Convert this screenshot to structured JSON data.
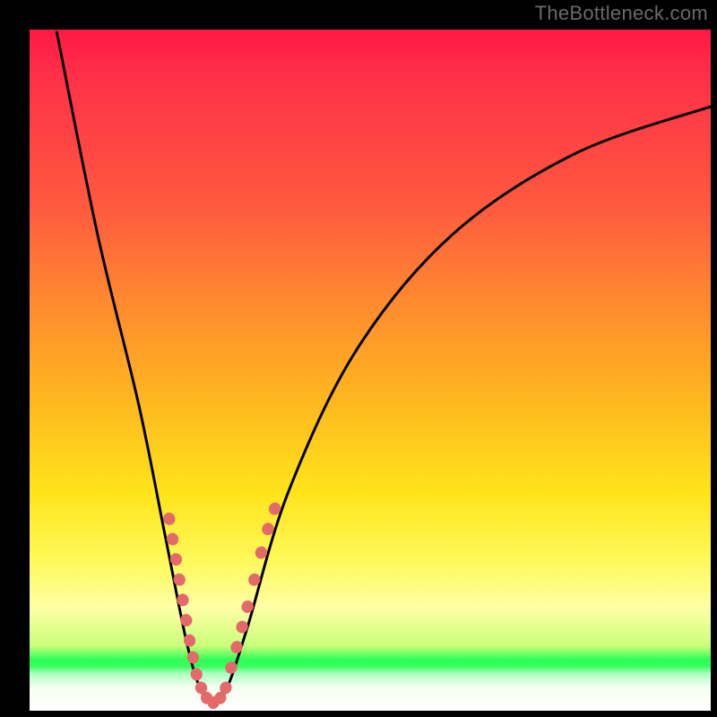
{
  "watermark": "TheBottleneck.com",
  "colors": {
    "frame": "#000000",
    "curve": "#000000",
    "marker_fill": "#e46a6a",
    "marker_stroke": "#b84a4a",
    "gradient_stops": [
      {
        "pos": 0.0,
        "hex": "#ff1845"
      },
      {
        "pos": 0.06,
        "hex": "#ff2e48"
      },
      {
        "pos": 0.26,
        "hex": "#ff5a3f"
      },
      {
        "pos": 0.4,
        "hex": "#ff8a2f"
      },
      {
        "pos": 0.55,
        "hex": "#ffb91f"
      },
      {
        "pos": 0.68,
        "hex": "#ffe41a"
      },
      {
        "pos": 0.78,
        "hex": "#fff95a"
      },
      {
        "pos": 0.85,
        "hex": "#feffa5"
      },
      {
        "pos": 0.905,
        "hex": "#c9ff7a"
      },
      {
        "pos": 0.925,
        "hex": "#2dff57"
      },
      {
        "pos": 0.935,
        "hex": "#38ff5e"
      },
      {
        "pos": 0.945,
        "hex": "#aaffbf"
      },
      {
        "pos": 0.965,
        "hex": "#f4fff0"
      },
      {
        "pos": 1.0,
        "hex": "#ffffff"
      }
    ]
  },
  "chart_data": {
    "type": "line",
    "title": "",
    "xlabel": "",
    "ylabel": "",
    "xlim": [
      0,
      100
    ],
    "ylim": [
      0,
      100
    ],
    "x_apex": 27,
    "series": [
      {
        "name": "bottleneck-curve",
        "points": [
          {
            "x": 4,
            "y": 100
          },
          {
            "x": 10,
            "y": 70
          },
          {
            "x": 16,
            "y": 45
          },
          {
            "x": 20,
            "y": 25
          },
          {
            "x": 23,
            "y": 10
          },
          {
            "x": 25,
            "y": 3
          },
          {
            "x": 27,
            "y": 0.5
          },
          {
            "x": 29,
            "y": 3
          },
          {
            "x": 32,
            "y": 12
          },
          {
            "x": 38,
            "y": 32
          },
          {
            "x": 48,
            "y": 53
          },
          {
            "x": 62,
            "y": 70
          },
          {
            "x": 80,
            "y": 82
          },
          {
            "x": 100,
            "y": 89
          }
        ]
      }
    ],
    "markers": [
      {
        "x": 20.5,
        "y": 28,
        "r": 1.1
      },
      {
        "x": 21.0,
        "y": 25,
        "r": 1.1
      },
      {
        "x": 21.5,
        "y": 22,
        "r": 1.1
      },
      {
        "x": 22.0,
        "y": 19,
        "r": 1.1
      },
      {
        "x": 22.5,
        "y": 16,
        "r": 1.1
      },
      {
        "x": 23.0,
        "y": 13,
        "r": 1.1
      },
      {
        "x": 23.5,
        "y": 10,
        "r": 1.1
      },
      {
        "x": 24.0,
        "y": 7.5,
        "r": 1.1
      },
      {
        "x": 24.5,
        "y": 5,
        "r": 1.1
      },
      {
        "x": 25.2,
        "y": 3,
        "r": 1.1
      },
      {
        "x": 26.0,
        "y": 1.5,
        "r": 1.1
      },
      {
        "x": 27.0,
        "y": 0.8,
        "r": 1.1
      },
      {
        "x": 28.0,
        "y": 1.5,
        "r": 1.1
      },
      {
        "x": 28.8,
        "y": 3,
        "r": 1.1
      },
      {
        "x": 29.6,
        "y": 6,
        "r": 1.1
      },
      {
        "x": 30.4,
        "y": 9,
        "r": 1.1
      },
      {
        "x": 31.2,
        "y": 12,
        "r": 1.1
      },
      {
        "x": 32.0,
        "y": 15,
        "r": 1.1
      },
      {
        "x": 33.0,
        "y": 19,
        "r": 1.1
      },
      {
        "x": 34.0,
        "y": 23,
        "r": 1.1
      },
      {
        "x": 35.0,
        "y": 26.5,
        "r": 1.1
      },
      {
        "x": 36.0,
        "y": 29.5,
        "r": 1.1
      }
    ]
  }
}
